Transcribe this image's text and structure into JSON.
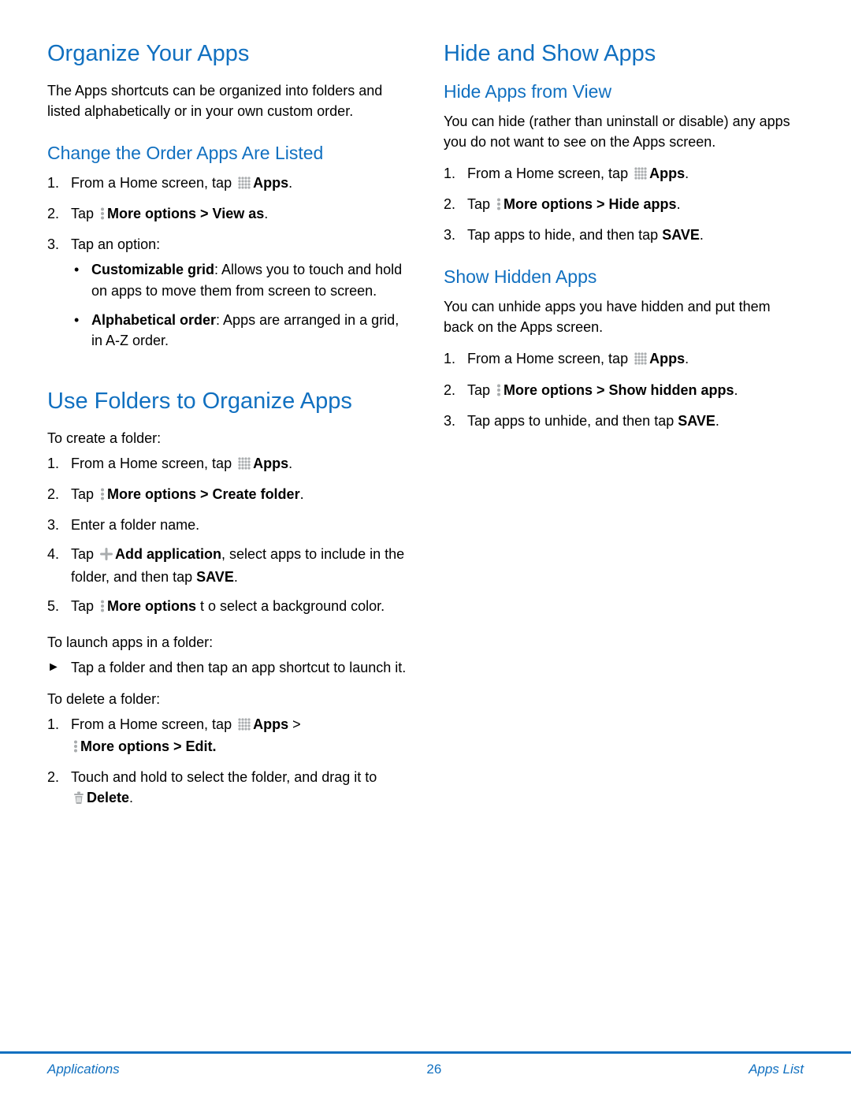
{
  "left": {
    "h1a": "Organize Your Apps",
    "introA": "The Apps shortcuts can be organized into folders and listed alphabetically or in your own custom order.",
    "h2a": "Change the Order Apps Are Listed",
    "ol_a1_pre": "From a Home screen, tap ",
    "ol_a1_b": "Apps",
    "ol_a2_pre": "Tap ",
    "ol_a2_b": "More options > View as",
    "ol_a3": "Tap an option:",
    "bul1_b": "Customizable grid",
    "bul1_t": ": Allows you to touch and hold on apps to move them from screen to screen.",
    "bul2_b": "Alphabetical order",
    "bul2_t": ": Apps are arranged in a grid, in A-Z order.",
    "h1b": "Use Folders to Organize Apps",
    "lead1": "To create a folder:",
    "ob1_pre": "From a Home screen, tap ",
    "ob1_b": "Apps",
    "ob2_pre": "Tap ",
    "ob2_b": "More options > Create folder",
    "ob3": "Enter a folder name.",
    "ob4_pre": "Tap ",
    "ob4_b": "Add application",
    "ob4_mid": ", select apps to include in the folder, and then tap ",
    "ob4_b2": "SAVE",
    "ob5_pre": "Tap ",
    "ob5_b": "More options",
    "ob5_post": " t o select a background color.",
    "lead2": "To launch apps in a folder:",
    "arrow1": "Tap a folder and then tap an app shortcut to launch it.",
    "lead3": "To delete a folder:",
    "oc1_pre": "From a Home screen, tap ",
    "oc1_b1": "Apps",
    "oc1_gt": " > ",
    "oc1_b2": "More options > Edit.",
    "oc2_pre": "Touch and hold to select the folder, and drag it to ",
    "oc2_b": "Delete"
  },
  "right": {
    "h1": "Hide and Show Apps",
    "h2a": "Hide Apps from View",
    "introA": "You can hide (rather than uninstall or disable) any apps you do not want to see on the Apps screen.",
    "ra1_pre": "From a Home screen, tap ",
    "ra1_b": "Apps",
    "ra2_pre": "Tap ",
    "ra2_b": "More options > Hide apps",
    "ra3_pre": "Tap apps to hide, and then tap ",
    "ra3_b": "SAVE",
    "h2b": "Show Hidden Apps",
    "introB": "You can unhide apps you have hidden and put them back on the Apps screen.",
    "rb1_pre": "From a Home screen, tap ",
    "rb1_b": "Apps",
    "rb2_pre": "Tap ",
    "rb2_b": "More options > Show hidden apps",
    "rb3_pre": "Tap apps to unhide, and then tap ",
    "rb3_b": "SAVE"
  },
  "footer": {
    "left": "Applications",
    "center": "26",
    "right": "Apps List"
  }
}
